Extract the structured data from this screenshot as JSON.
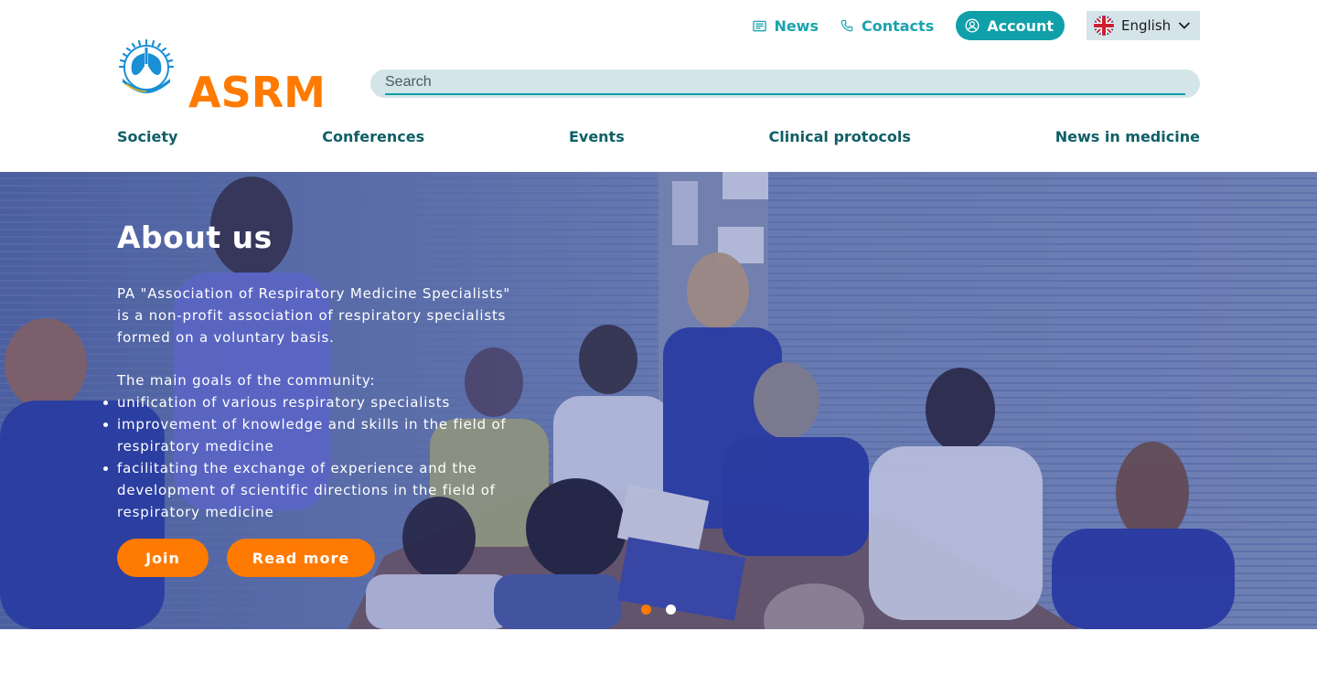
{
  "topbar": {
    "news_label": "News",
    "contacts_label": "Contacts",
    "account_label": "Account",
    "language_label": "English"
  },
  "logo": {
    "text": "ASRM"
  },
  "search": {
    "placeholder": "Search",
    "value": ""
  },
  "nav": {
    "items": [
      {
        "label": "Society"
      },
      {
        "label": "Conferences"
      },
      {
        "label": "Events"
      },
      {
        "label": "Clinical protocols"
      },
      {
        "label": "News in medicine"
      }
    ]
  },
  "hero": {
    "title": "About us",
    "intro": "PA \"Association of Respiratory Medicine Specialists\" is a non-profit association of respiratory specialists formed on a voluntary basis.",
    "goals_heading": "The main goals of the community:",
    "goals": [
      "unification of various respiratory specialists",
      "improvement of knowledge and skills in the field of respiratory medicine",
      "facilitating the exchange of experience and the development of scientific directions in the field of respiratory medicine"
    ],
    "join_label": "Join",
    "read_more_label": "Read more",
    "slides_total": 2,
    "active_slide": 1
  },
  "colors": {
    "brand_orange": "#ff7a00",
    "brand_teal": "#10a0a9",
    "nav_text": "#0f5f66",
    "search_bg": "#d3e5e8"
  },
  "icons": {
    "news": "newspaper-icon",
    "contacts": "phone-icon",
    "account": "user-circle-icon",
    "language": "uk-flag-icon",
    "dropdown": "chevron-down-icon",
    "logo": "lungs-emblem-icon"
  }
}
